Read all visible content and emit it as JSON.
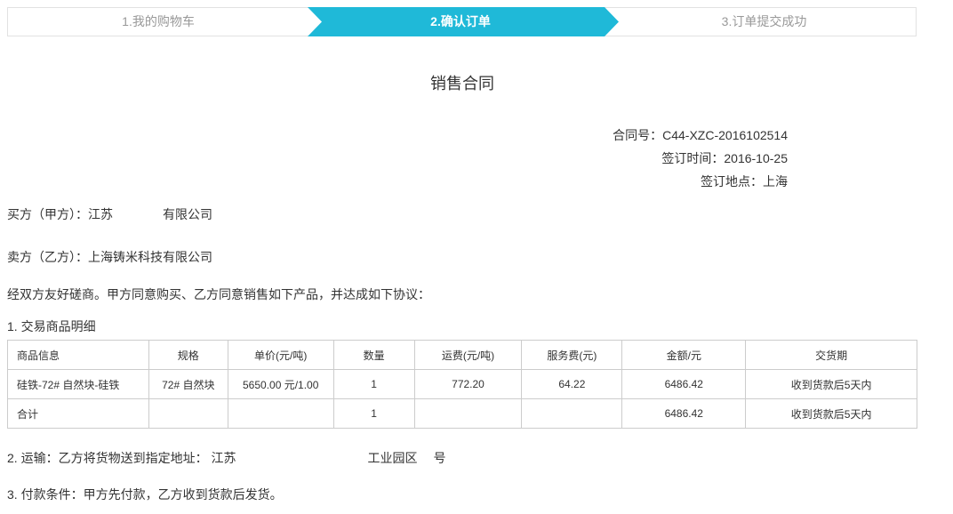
{
  "steps": [
    {
      "label": "1.我的购物车",
      "state": "done"
    },
    {
      "label": "2.确认订单",
      "state": "active"
    },
    {
      "label": "3.订单提交成功",
      "state": "todo"
    }
  ],
  "colors": {
    "active_step": "#1fb9d8",
    "step_border": "#e2e2e2",
    "table_border": "#cccccc"
  },
  "contract": {
    "title": "销售合同",
    "number_label": "合同号：",
    "number": "C44-XZC-2016102514",
    "date_label": "签订时间：",
    "date": "2016-10-25",
    "place_label": "签订地点：",
    "place": "上海",
    "buyer_label": "买方（甲方）：",
    "buyer_prefix": "江苏",
    "buyer_suffix": "有限公司",
    "seller_label": "卖方（乙方）：",
    "seller": "上海铸米科技有限公司",
    "intro": "经双方友好磋商。甲方同意购买、乙方同意销售如下产品，并达成如下协议：",
    "section1": "1. 交易商品明细",
    "shipping_label": "2. 运输：乙方将货物送到指定地址：",
    "shipping_prefix": "江苏",
    "shipping_mid": "工业园区",
    "shipping_suffix": "号",
    "payment": "3. 付款条件：甲方先付款，乙方收到货款后发货。"
  },
  "table": {
    "headers": [
      "商品信息",
      "规格",
      "单价(元/吨)",
      "数量",
      "运费(元/吨)",
      "服务费(元)",
      "金额/元",
      "交货期"
    ],
    "rows": [
      [
        "硅铁-72# 自然块-硅铁",
        "72# 自然块",
        "5650.00 元/1.00",
        "1",
        "772.20",
        "64.22",
        "6486.42",
        "收到货款后5天内"
      ],
      [
        "合计",
        "",
        "",
        "1",
        "",
        "",
        "6486.42",
        "收到货款后5天内"
      ]
    ]
  }
}
